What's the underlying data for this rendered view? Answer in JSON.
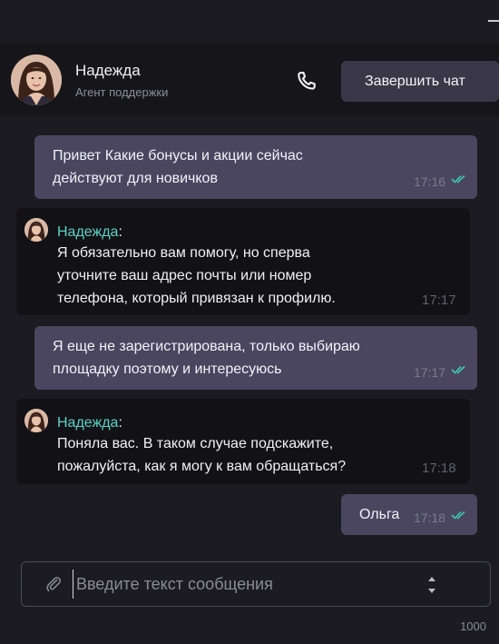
{
  "header": {
    "agent_name": "Надежда",
    "agent_role": "Агент поддержки",
    "end_chat_label": "Завершить чат"
  },
  "messages": [
    {
      "from": "user",
      "text": "Привет Какие бонусы и акции сейчас\nдействуют для новичков",
      "time": "17:16",
      "read": true
    },
    {
      "from": "agent",
      "sender": "Надежда",
      "text": "Я обязательно вам помогу, но сперва\nуточните ваш адрес почты или номер\nтелефона, который привязан к профилю.",
      "time": "17:17"
    },
    {
      "from": "user",
      "text": "Я еще не зарегистрирована, только выбираю\nплощадку поэтому и интересуюсь",
      "time": "17:17",
      "read": true
    },
    {
      "from": "agent",
      "sender": "Надежда",
      "text": "Поняла вас. В таком случае подскажите,\nпожалуйста, как я могу к вам обращаться?",
      "time": "17:18"
    },
    {
      "from": "user",
      "text": "Ольга",
      "time": "17:18",
      "read": true
    }
  ],
  "composer": {
    "placeholder": "Введите текст сообщения",
    "value": "",
    "char_limit": "1000"
  },
  "colors": {
    "outgoing_bubble": "#4a4660",
    "incoming_bubble": "#121216",
    "sender_name": "#5ad2c6",
    "read_check": "#3fc8b4",
    "background": "#1b1b21"
  },
  "icons": {
    "phone": "phone-icon",
    "attach": "paperclip-icon",
    "read": "double-check-icon",
    "stepper": "stepper-icon",
    "minimize": "minimize-icon"
  }
}
